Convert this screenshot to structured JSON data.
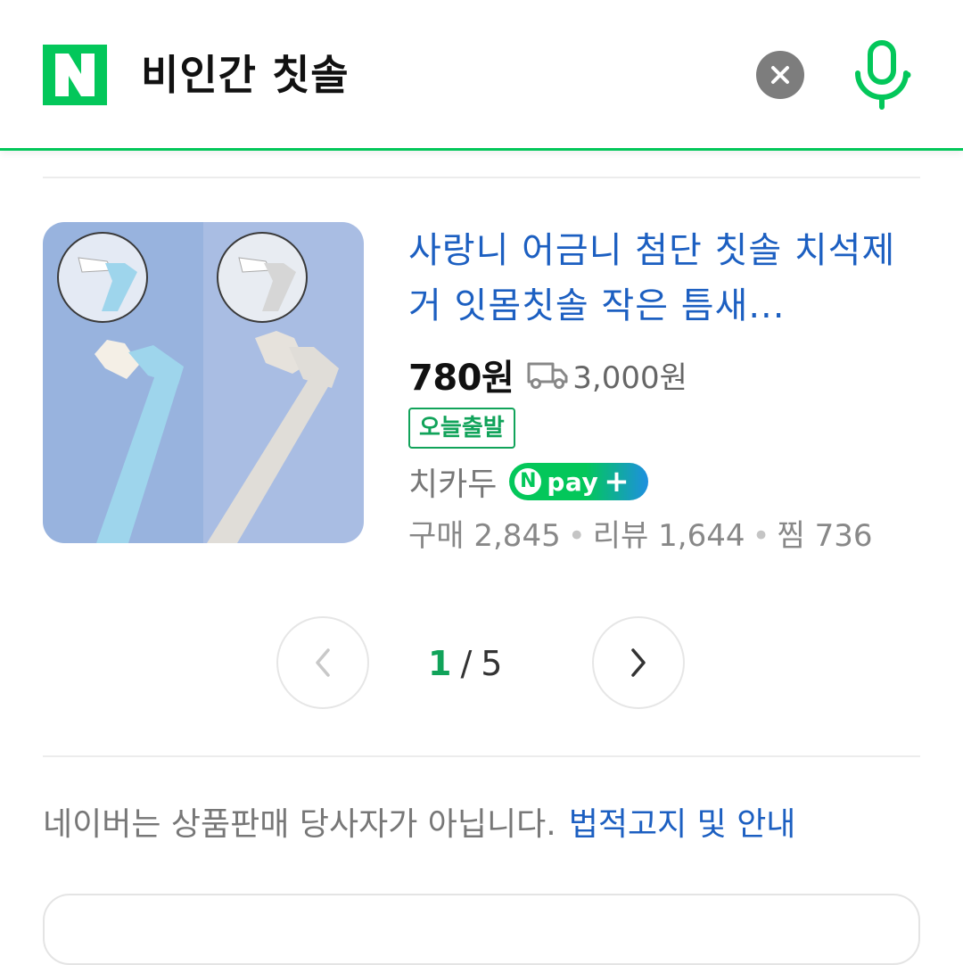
{
  "search": {
    "logo_letter": "N",
    "query": "비인간 칫솔",
    "clear_icon": "close-icon",
    "mic_icon": "microphone-icon"
  },
  "product": {
    "title": "사랑니 어금니 첨단 칫솔 치석제거 잇몸칫솔 작은 틈새...",
    "price": "780원",
    "shipping_icon": "truck-icon",
    "shipping": "3,000원",
    "badge": "오늘출발",
    "seller": "치카두",
    "npay": {
      "n": "N",
      "text": "pay",
      "plus": "+"
    },
    "stats": {
      "purchases": "구매 2,845",
      "reviews": "리뷰 1,644",
      "wishes": "찜 736"
    }
  },
  "pagination": {
    "current": "1",
    "separator": "/",
    "total": "5"
  },
  "notice": {
    "text": "네이버는 상품판매 당사자가 아닙니다.",
    "link": "법적고지 및 안내"
  },
  "colors": {
    "brand_green": "#03c75a",
    "link_blue": "#1c5fc1",
    "npay_blue": "#1e8fe0"
  }
}
